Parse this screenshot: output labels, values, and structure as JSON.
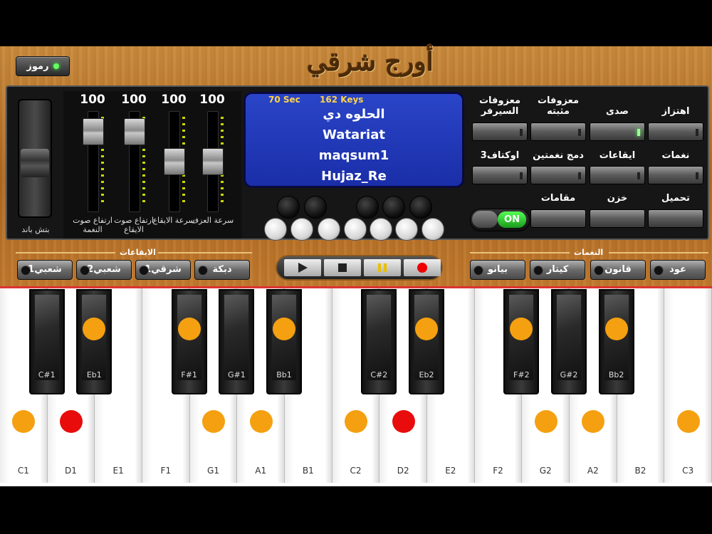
{
  "app": {
    "title": "أورج شرقي",
    "codes_button": "رموز"
  },
  "pitch": {
    "label": "بتش باند"
  },
  "sliders": [
    {
      "value": "100",
      "label": "ارتفاع صوت النغمة",
      "level": 0.9
    },
    {
      "value": "100",
      "label": "ارتفاع صوت الايقاع",
      "level": 0.9
    },
    {
      "value": "100",
      "label": "سرعة الايقاع",
      "level": 0.5
    },
    {
      "value": "100",
      "label": "سرعة العزف",
      "level": 0.5
    }
  ],
  "display": {
    "seconds": "70 Sec",
    "keys": "162 Keys",
    "lines": [
      "الحلوه دي",
      "Watariat",
      "maqsum1",
      "Hujaz_Re"
    ]
  },
  "functions": {
    "row1": [
      {
        "label": "معزوفات السيرفر",
        "on": false
      },
      {
        "label": "معزوفات مثبته",
        "on": false
      },
      {
        "label": "صدى",
        "on": true
      },
      {
        "label": "اهتزاز",
        "on": false
      }
    ],
    "row2": [
      {
        "label": "اوكتاف3",
        "on": false
      },
      {
        "label": "دمج نغمتين",
        "on": false
      },
      {
        "label": "ايقاعات",
        "on": false
      },
      {
        "label": "نغمات",
        "on": false
      }
    ],
    "row3": [
      {
        "label": "مقامات"
      },
      {
        "label": "خزن"
      },
      {
        "label": "تحميل"
      }
    ],
    "power": "ON"
  },
  "rhythms": {
    "title": "الايقاعات",
    "items": [
      "شعبي1",
      "شعبي2",
      "شرقي1",
      "دبكة"
    ]
  },
  "tones": {
    "title": "النغمات",
    "items": [
      "بيانو",
      "كيتار",
      "قانون",
      "عود"
    ]
  },
  "transport": {
    "buttons": [
      "play-icon",
      "stop-icon",
      "pause-icon",
      "record-icon"
    ]
  },
  "keyboard": {
    "white_keys": [
      {
        "label": "C1",
        "mark": "orange"
      },
      {
        "label": "D1",
        "mark": "red"
      },
      {
        "label": "E1",
        "mark": ""
      },
      {
        "label": "F1",
        "mark": ""
      },
      {
        "label": "G1",
        "mark": "orange"
      },
      {
        "label": "A1",
        "mark": "orange"
      },
      {
        "label": "B1",
        "mark": ""
      },
      {
        "label": "C2",
        "mark": "orange"
      },
      {
        "label": "D2",
        "mark": "red"
      },
      {
        "label": "E2",
        "mark": ""
      },
      {
        "label": "F2",
        "mark": ""
      },
      {
        "label": "G2",
        "mark": "orange"
      },
      {
        "label": "A2",
        "mark": "orange"
      },
      {
        "label": "B2",
        "mark": ""
      },
      {
        "label": "C3",
        "mark": "orange"
      }
    ],
    "black_keys": [
      {
        "label": "C#1",
        "mark": ""
      },
      {
        "label": "Eb1",
        "mark": "orange"
      },
      {
        "label": "F#1",
        "mark": "orange"
      },
      {
        "label": "G#1",
        "mark": ""
      },
      {
        "label": "Bb1",
        "mark": "orange"
      },
      {
        "label": "C#2",
        "mark": ""
      },
      {
        "label": "Eb2",
        "mark": "orange"
      },
      {
        "label": "F#2",
        "mark": "orange"
      },
      {
        "label": "G#2",
        "mark": ""
      },
      {
        "label": "Bb2",
        "mark": "orange"
      }
    ],
    "colors": {
      "orange": "#f5a010",
      "red": "#e80c0c"
    }
  }
}
